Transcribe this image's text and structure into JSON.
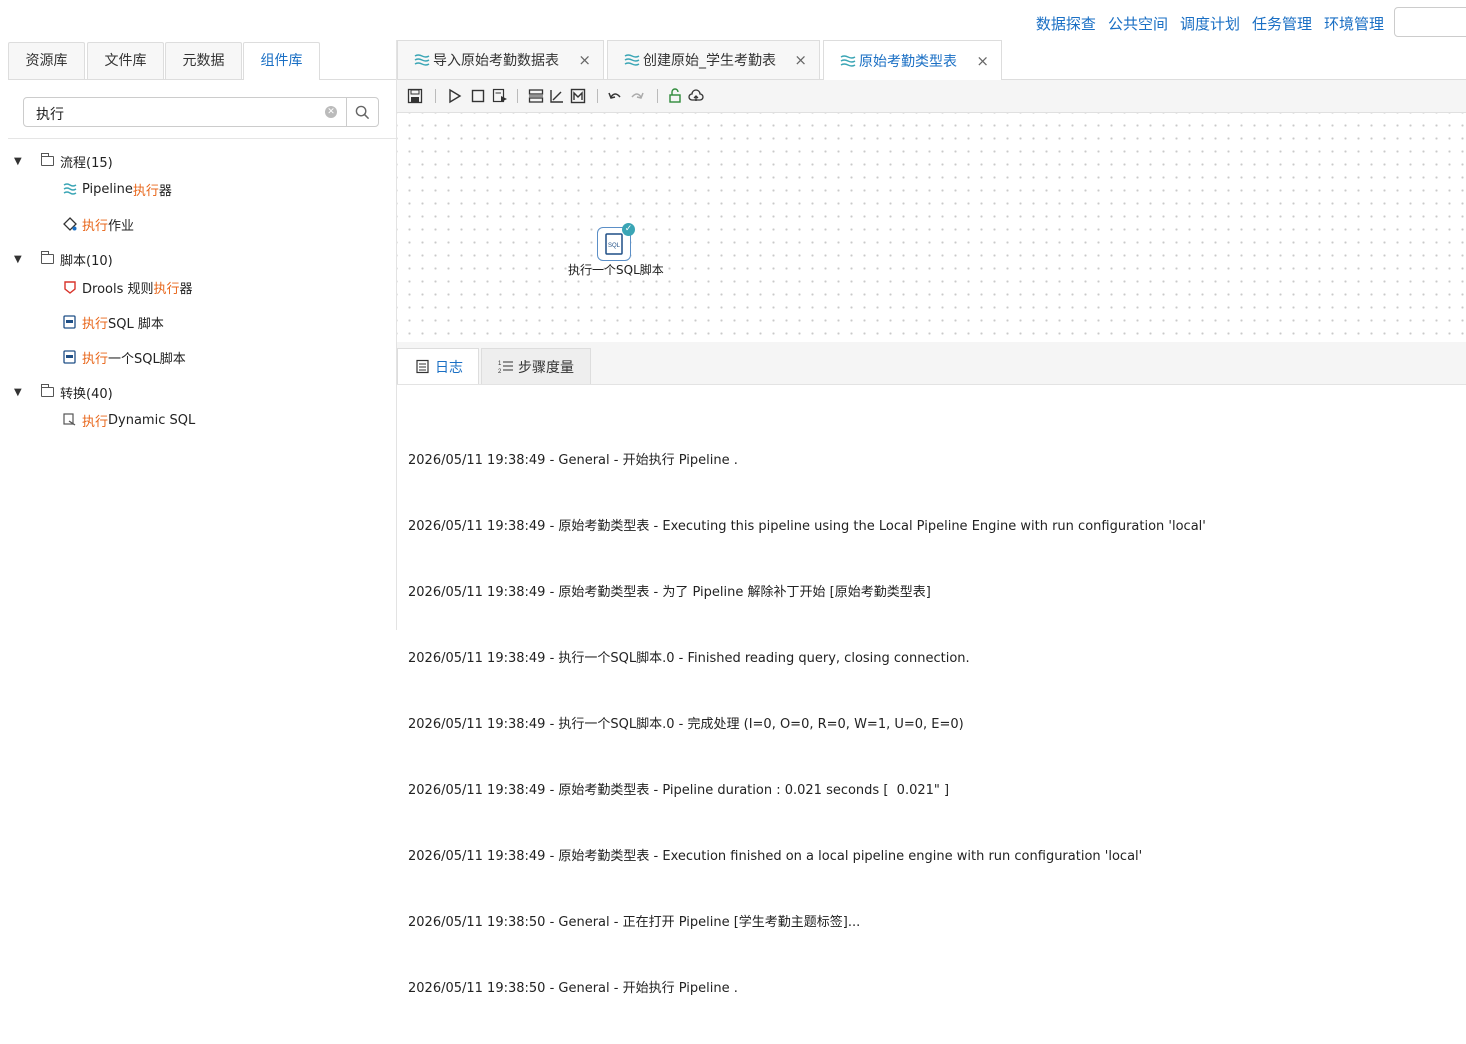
{
  "top_nav": [
    "数据探查",
    "公共空间",
    "调度计划",
    "任务管理",
    "环境管理"
  ],
  "left_tabs": [
    "资源库",
    "文件库",
    "元数据",
    "组件库"
  ],
  "search": {
    "value": "执行"
  },
  "tree": {
    "groups": [
      {
        "name": "流程(15)",
        "items": [
          {
            "pre": "Pipeline ",
            "hl": "执行",
            "post": " 器"
          },
          {
            "pre": "",
            "hl": "执行",
            "post": " 作业"
          }
        ]
      },
      {
        "name": "脚本(10)",
        "items": [
          {
            "pre": "Drools 规则 ",
            "hl": "执行",
            "post": " 器"
          },
          {
            "pre": "",
            "hl": "执行",
            "post": " SQL 脚本"
          },
          {
            "pre": "",
            "hl": "执行",
            "post": " 一个SQL脚本"
          }
        ]
      },
      {
        "name": "转换(40)",
        "items": [
          {
            "pre": "",
            "hl": "执行",
            "post": " Dynamic SQL"
          }
        ]
      }
    ]
  },
  "editor_tabs": [
    "导入原始考勤数据表",
    "创建原始_学生考勤表",
    "原始考勤类型表"
  ],
  "close_glyph": "×",
  "canvas_node": {
    "label": "执行一个SQL脚本",
    "icon_text": "SQL"
  },
  "bottom_tabs": [
    "日志",
    "步骤度量"
  ],
  "log_lines": [
    "2026/05/11 19:38:49 - General - 开始执行 Pipeline .",
    "2026/05/11 19:38:49 - 原始考勤类型表 - Executing this pipeline using the Local Pipeline Engine with run configuration 'local'",
    "2026/05/11 19:38:49 - 原始考勤类型表 - 为了 Pipeline 解除补丁开始 [原始考勤类型表]",
    "2026/05/11 19:38:49 - 执行一个SQL脚本.0 - Finished reading query, closing connection.",
    "2026/05/11 19:38:49 - 执行一个SQL脚本.0 - 完成处理 (I=0, O=0, R=0, W=1, U=0, E=0)",
    "2026/05/11 19:38:49 - 原始考勤类型表 - Pipeline duration : 0.021 seconds [  0.021\" ]",
    "2026/05/11 19:38:49 - 原始考勤类型表 - Execution finished on a local pipeline engine with run configuration 'local'",
    "2026/05/11 19:38:50 - General - 正在打开 Pipeline [学生考勤主题标签]...",
    "2026/05/11 19:38:50 - General - 开始执行 Pipeline ."
  ],
  "colors": {
    "accent": "#1a6fc4",
    "highlight": "#e8661a",
    "pipeline_icon": "#3aa5b5"
  }
}
